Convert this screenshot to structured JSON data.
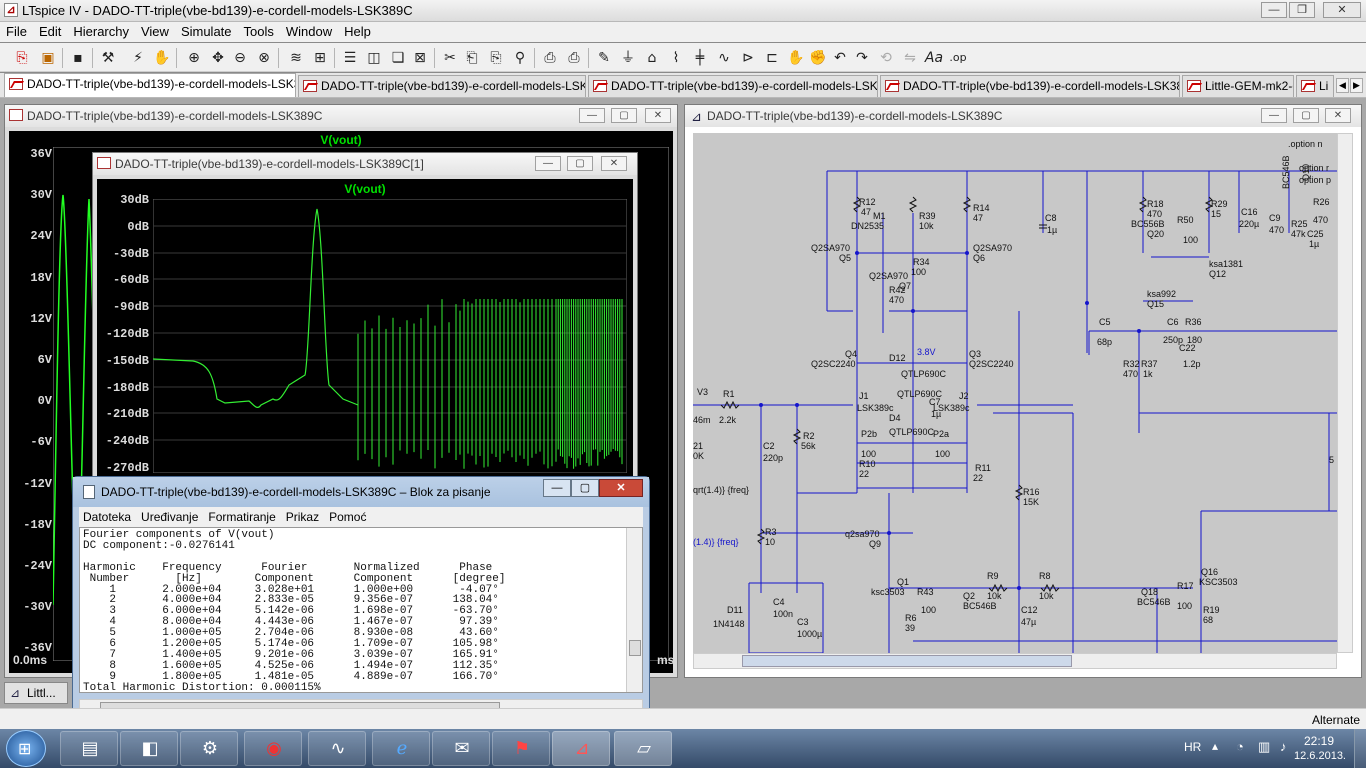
{
  "app": {
    "title": "LTspice IV - DADO-TT-triple(vbe-bd139)-e-cordell-models-LSK389C",
    "icon": "ltspice-app-icon"
  },
  "menu": [
    "File",
    "Edit",
    "Hierarchy",
    "View",
    "Simulate",
    "Tools",
    "Window",
    "Help"
  ],
  "tabs": [
    {
      "label": "DADO-TT-triple(vbe-bd139)-e-cordell-models-LSK389C",
      "icon": "waveform-icon"
    },
    {
      "label": "DADO-TT-triple(vbe-bd139)-e-cordell-models-LSK389C",
      "icon": "waveform-icon"
    },
    {
      "label": "DADO-TT-triple(vbe-bd139)-e-cordell-models-LSK389C",
      "icon": "schematic-icon"
    },
    {
      "label": "DADO-TT-triple(vbe-bd139)-e-cordell-models-LSK389C[1]",
      "icon": "waveform-icon"
    },
    {
      "label": "Little-GEM-mk2-d",
      "icon": "schematic-icon"
    },
    {
      "label": "Li",
      "icon": "schematic-icon"
    }
  ],
  "wave1": {
    "title": "DADO-TT-triple(vbe-bd139)-e-cordell-models-LSK389C",
    "trace": "V(vout)",
    "yticks": [
      "36V",
      "30V",
      "24V",
      "18V",
      "12V",
      "6V",
      "0V",
      "-6V",
      "-12V",
      "-18V",
      "-24V",
      "-30V",
      "-36V"
    ],
    "xstart": "0.0ms",
    "xend": "ms",
    "trace_color": "#00ff00"
  },
  "wave2": {
    "title": "DADO-TT-triple(vbe-bd139)-e-cordell-models-LSK389C[1]",
    "trace": "V(vout)",
    "yticks": [
      "30dB",
      "0dB",
      "-30dB",
      "-60dB",
      "-90dB",
      "-120dB",
      "-150dB",
      "-180dB",
      "-210dB",
      "-240dB",
      "-270dB"
    ]
  },
  "schematic": {
    "title": "DADO-TT-triple(vbe-bd139)-e-cordell-models-LSK389C",
    "labels": {
      "option1": ".option n",
      "option2": "option r",
      "option3": "option p",
      "R12": "R12",
      "R12v": "47",
      "M1": "M1",
      "M1m": "DN2535",
      "R39": "R39",
      "R39v": "10k",
      "R14": "R14",
      "R14v": "47",
      "C8": "C8",
      "C8v": "1µ",
      "R18": "R18",
      "R18v": "470",
      "BC556B": "BC556B",
      "Q20": "Q20",
      "R29": "R29",
      "R29v": "15",
      "R50": "R50",
      "R50v": "100",
      "C16": "C16",
      "C16v": "220µ",
      "C9": "C9",
      "C9v": "470",
      "R25": "R25",
      "R25v": "47k",
      "C25": "C25",
      "C25v": "1µ",
      "R26": "R26",
      "R26v": "470",
      "BC546B": "BC546B",
      "Q10": "Q10",
      "Q5m": "Q2SA970",
      "Q5": "Q5",
      "Q6m": "Q2SA970",
      "Q6": "Q6",
      "R34": "R34",
      "R34v": "100",
      "Q7m": "Q2SA970",
      "Q7": "Q7",
      "R42": "R42",
      "R42v": "470",
      "ksa1381": "ksa1381",
      "Q12": "Q12",
      "ksa992": "ksa992",
      "Q15": "Q15",
      "C5": "C5",
      "C5v": "68p",
      "C6": "C6",
      "C6v": "250p",
      "R36": "R36",
      "R36v": "180",
      "C22": "C22",
      "C22v": "1.2p",
      "R32": "R32",
      "R32v": "470",
      "R37": "R37",
      "R37v": "1k",
      "Q4": "Q4",
      "Q4m": "Q2SC2240",
      "D12": "D12",
      "V38": "3.8V",
      "Q3": "Q3",
      "Q3m": "Q2SC2240",
      "D2": "QTLP690C",
      "D3": "QTLP690C",
      "D4": "D4",
      "D4m": "QTLP690C",
      "V3": "V3",
      "V3v": "46m",
      "R1": "R1",
      "R1v": "2.2k",
      "J1": "J1",
      "J1m": "LSK389c",
      "C7": "C7",
      "C7v": "1µ",
      "J2": "J2",
      "J2m": "LSK389c",
      "P2b": "P2b",
      "P2bv": "100",
      "P2a": "P2a",
      "P2av": "100",
      "R10": "R10",
      "R10v": "22",
      "R11": "R11",
      "R11v": "22",
      "C2": "C2",
      "C2v": "220p",
      "R2": "R2",
      "R2v": "56k",
      "R21": "21",
      "R21v": "0K",
      "sqrt1": "qrt(1.4)} {freq}",
      "sqrt2": "(1.4)} {freq}",
      "R16": "R16",
      "R16v": "15K",
      "R3": "R3",
      "R3v": "10",
      "Q9m": "q2sa970",
      "Q9": "Q9",
      "Q1": "Q1",
      "Q1m": "ksc3503",
      "R43": "R43",
      "R43v": "100",
      "R9": "R9",
      "R9v": "10k",
      "R8": "R8",
      "R8v": "10k",
      "Q2": "Q2",
      "Q2m": "BC546B",
      "Q16": "Q16",
      "Q16m": "KSC3503",
      "Q18": "Q18",
      "Q18m": "BC546B",
      "R17": "R17",
      "R17v": "100",
      "R19": "R19",
      "R19v": "68",
      "D11": "D11",
      "D11m": "1N4148",
      "C4": "C4",
      "C4v": "100n",
      "C3": "C3",
      "C3v": "1000µ",
      "R6": "R6",
      "R6v": "39",
      "C12": "C12",
      "C12v": "47µ",
      "R5": "5"
    }
  },
  "notepad": {
    "title": "DADO-TT-triple(vbe-bd139)-e-cordell-models-LSK389C – Blok za pisanje",
    "menu": [
      "Datoteka",
      "Uređivanje",
      "Formatiranje",
      "Prikaz",
      "Pomoć"
    ],
    "lines": [
      "Fourier components of V(vout)",
      "DC component:-0.0276141",
      "",
      "Harmonic    Frequency      Fourier       Normalized      Phase",
      " Number       [Hz]        Component      Component      [degree]",
      "    1       2.000e+04     3.028e+01      1.000e+00       -4.07°",
      "    2       4.000e+04     2.833e-05      9.356e-07      138.04°",
      "    3       6.000e+04     5.142e-06      1.698e-07      -63.70°",
      "    4       8.000e+04     4.443e-06      1.467e-07       97.39°",
      "    5       1.000e+05     2.704e-06      8.930e-08       43.60°",
      "    6       1.200e+05     5.174e-06      1.709e-07      105.98°",
      "    7       1.400e+05     9.201e-06      3.039e-07      165.91°",
      "    8       1.600e+05     4.525e-06      1.494e-07      112.35°",
      "    9       1.800e+05     1.481e-05      4.889e-07      166.70°",
      "Total Harmonic Distortion: 0.000115%"
    ]
  },
  "minimized": {
    "label": "Littl..."
  },
  "status": {
    "right": "Alternate"
  },
  "taskbar": {
    "apps": [
      "explorer",
      "media",
      "system",
      "ccleaner",
      "oscilloscope",
      "internet-explorer",
      "email",
      "acrobat",
      "ltspice",
      "notepad"
    ],
    "lang": "HR",
    "time": "22:19",
    "date": "12.6.2013."
  }
}
